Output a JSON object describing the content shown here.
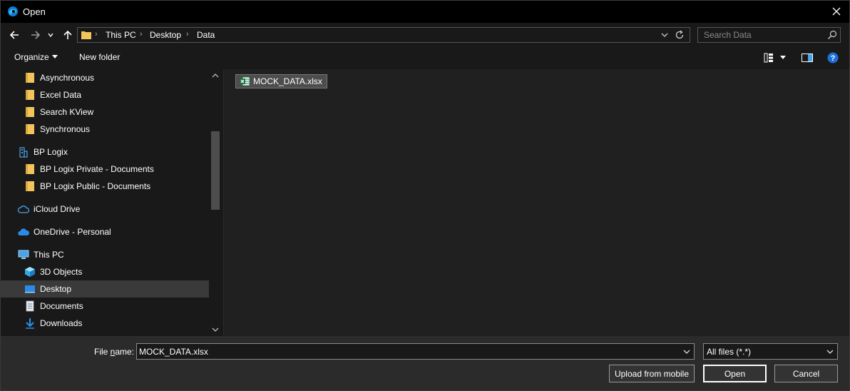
{
  "window": {
    "title": "Open"
  },
  "address": {
    "crumbs": [
      "This PC",
      "Desktop",
      "Data"
    ]
  },
  "search": {
    "placeholder": "Search Data"
  },
  "toolbar": {
    "organize": "Organize",
    "new_folder": "New folder"
  },
  "nav": {
    "items": [
      {
        "label": "Asynchronous",
        "icon": "folder-icon"
      },
      {
        "label": "Excel Data",
        "icon": "folder-icon"
      },
      {
        "label": "Search KView",
        "icon": "folder-icon"
      },
      {
        "label": "Synchronous",
        "icon": "folder-icon"
      },
      {
        "label": "BP Logix",
        "icon": "building-icon"
      },
      {
        "label": "BP Logix Private - Documents",
        "icon": "folder-icon"
      },
      {
        "label": "BP Logix Public - Documents",
        "icon": "folder-icon"
      },
      {
        "label": "iCloud Drive",
        "icon": "icloud-icon"
      },
      {
        "label": "OneDrive - Personal",
        "icon": "onedrive-icon"
      },
      {
        "label": "This PC",
        "icon": "computer-icon"
      },
      {
        "label": "3D Objects",
        "icon": "cube-icon"
      },
      {
        "label": "Desktop",
        "icon": "desktop-icon",
        "selected": true
      },
      {
        "label": "Documents",
        "icon": "document-icon"
      },
      {
        "label": "Downloads",
        "icon": "download-icon"
      }
    ]
  },
  "content": {
    "files": [
      {
        "name": "MOCK_DATA.xlsx",
        "icon": "excel-icon"
      }
    ]
  },
  "bottom": {
    "file_name_label_prefix": "File ",
    "file_name_label_underlined": "n",
    "file_name_label_suffix": "ame:",
    "file_name_value": "MOCK_DATA.xlsx",
    "file_type": "All files (*.*)",
    "upload_button": "Upload from mobile",
    "open_button": "Open",
    "cancel_button": "Cancel"
  },
  "colors": {
    "folder": "#f2c55c",
    "accent_blue": "#1e90ff",
    "excel_green": "#1d6f42",
    "selection": "#3a3a3a"
  }
}
